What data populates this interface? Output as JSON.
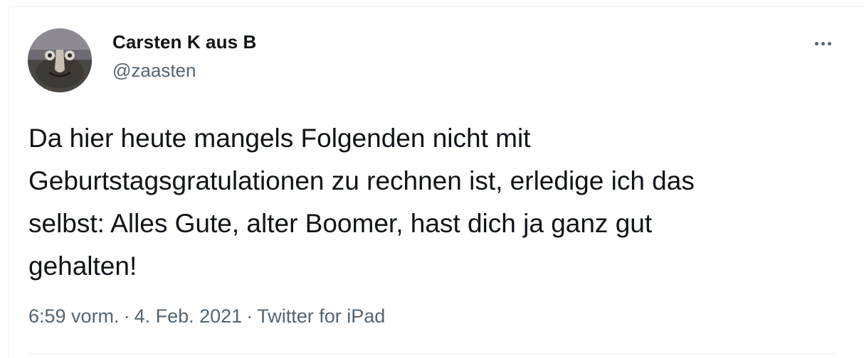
{
  "author": {
    "name": "Carsten K aus B",
    "handle": "@zaasten"
  },
  "icons": {
    "avatar": "profile-avatar",
    "more": "more-horizontal-icon"
  },
  "tweet": {
    "lines": [
      "Da hier heute mangels Folgenden nicht mit",
      "Geburtstagsgratulationen zu rechnen ist, erledige ich das",
      "selbst: Alles Gute, alter Boomer, hast dich ja ganz gut",
      "gehalten!"
    ]
  },
  "meta": {
    "time": "6:59 vorm.",
    "separator": "·",
    "date": "4. Feb. 2021",
    "source": "Twitter for iPad"
  },
  "colors": {
    "text": "#0f1419",
    "secondary": "#536471",
    "border": "#eff3f4"
  }
}
